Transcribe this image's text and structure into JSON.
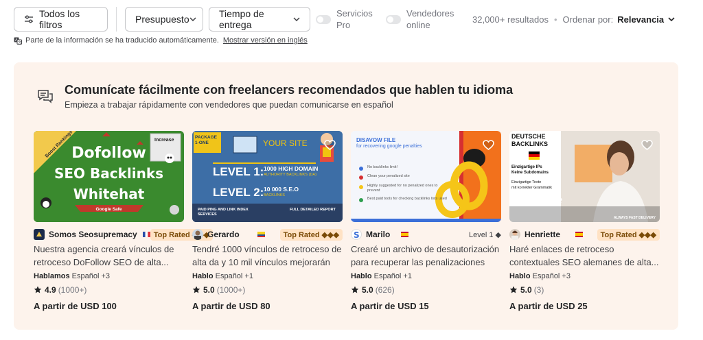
{
  "filters": {
    "all_filters": "Todos los filtros",
    "budget": "Presupuesto",
    "delivery": "Tiempo de entrega",
    "pro_services": "Servicios Pro",
    "online_sellers": "Vendedores online",
    "results": "32,000+ resultados",
    "sort_label": "Ordenar por:",
    "sort_value": "Relevancia"
  },
  "translation": {
    "note": "Parte de la información se ha traducido automáticamente.",
    "link": "Mostrar versión en inglés"
  },
  "promo": {
    "title": "Comunícate fácilmente con freelancers recomendados que hablen tu idioma",
    "subtitle": "Empieza a trabajar rápidamente con vendedores que puedan comunicarse en español"
  },
  "cards": [
    {
      "seller": "Somos Seosupremacy",
      "flag": "france",
      "badge": "Top Rated ◆◆◆",
      "description": "Nuestra agencia creará vínculos de retroceso DoFollow SEO de alta...",
      "lang_label": "Hablamos",
      "lang_value": "Español +3",
      "rating": "4.9",
      "reviews": "(1000+)",
      "price": "A partir de USD 100",
      "thumb": {
        "tag": "Boost Rankings",
        "line1": "Dofollow",
        "line2": "SEO Backlinks",
        "line3": "Whitehat",
        "ribbon": "Google Safe",
        "corner": "Increase"
      }
    },
    {
      "seller": "Gerardo",
      "flag": "ecuador",
      "badge": "Top Rated ◆◆◆",
      "description": "Tendré 1000 vínculos de retroceso de alta da y 10 mil vínculos mejorarán el...",
      "lang_label": "Hablo",
      "lang_value": "Español +1",
      "rating": "5.0",
      "reviews": "(1000+)",
      "price": "A partir de USD 80",
      "thumb": {
        "package": "PACKAGE 1-ONE",
        "site": "YOUR SITE",
        "level1": "LEVEL 1:",
        "level1_text": "1000 HIGH DOMAIN",
        "level1_sub": "AUTHORITY BACKLINKS (DA)",
        "level2": "LEVEL 2:",
        "level2_text": "10 000 S.E.O",
        "level2_sub": "BACKLINKS",
        "foot_left": "PAID PING AND LINK INDEX SERVICES",
        "foot_right": "FULL DETAILED REPORT"
      }
    },
    {
      "seller": "Marilo",
      "flag": "spain",
      "level": "Level 1 ◆",
      "description": "Crearé un archivo de desautorización para recuperar las penalizaciones de...",
      "lang_label": "Hablo",
      "lang_value": "Español +1",
      "rating": "5.0",
      "reviews": "(626)",
      "price": "A partir de USD 15",
      "thumb": {
        "title": "DISAVOW FILE",
        "subtitle": "for recovering google penalties",
        "items": [
          "No backlinks limit!",
          "Clean your penalized site",
          "Highly suggested for no penalized ones to prevent",
          "Best paid tools for checking backlinks lists used"
        ]
      }
    },
    {
      "seller": "Henriette",
      "flag": "spain",
      "badge": "Top Rated ◆◆◆",
      "description": "Haré enlaces de retroceso contextuales SEO alemanes de alta...",
      "lang_label": "Hablo",
      "lang_value": "Español +3",
      "rating": "5.0",
      "reviews": "(3)",
      "price": "A partir de USD 25",
      "thumb": {
        "title1": "DEUTSCHE",
        "title2": "BACKLINKS",
        "t1": "Einzigartige IPs",
        "t2": "Keine Subdomains",
        "t3": "Einzigartige Texte",
        "t4": "mit korrekter Grammatik",
        "signature": "Henriette",
        "footer": "ALWAYS FAST DELIVERY"
      }
    }
  ]
}
